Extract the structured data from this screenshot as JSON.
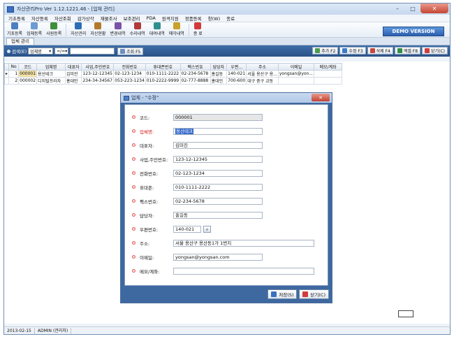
{
  "window": {
    "title": "자산관리Pro Ver 1.12.1221.46 - [업체 관리]"
  },
  "menu": [
    "기초등록",
    "자산등록",
    "자산조회",
    "감가상각",
    "재물조사",
    "보조관리",
    "PDA",
    "원격지원",
    "정품등록",
    "창(W)",
    "종료"
  ],
  "toolbar": {
    "buttons": [
      {
        "label": "기초등록",
        "icon": "folder-icon",
        "color": "#4a7fc1"
      },
      {
        "label": "업체등록",
        "icon": "building-icon",
        "color": "#6b9bd2"
      },
      {
        "label": "사원등록",
        "icon": "user-icon",
        "color": "#3f8e3a"
      },
      {
        "label": "자산관리",
        "icon": "box-icon",
        "color": "#2c6db3"
      },
      {
        "label": "자산현황",
        "icon": "chart-icon",
        "color": "#b37a2c"
      },
      {
        "label": "변경내역",
        "icon": "list-icon",
        "color": "#7a52a8"
      },
      {
        "label": "수리내역",
        "icon": "wrench-icon",
        "color": "#b23a3a"
      },
      {
        "label": "대여내역",
        "icon": "handover-icon",
        "color": "#2f8f8f"
      },
      {
        "label": "매각내역",
        "icon": "sale-icon",
        "color": "#c9a22a"
      },
      {
        "label": "종 료",
        "icon": "power-icon",
        "color": "#d23b3b"
      }
    ],
    "demo_label": "DEMO VERSION"
  },
  "tab": {
    "label": "업체 관리"
  },
  "search": {
    "label": "검색(E)",
    "field_select": "업체명",
    "op_select": "=/=",
    "query": "",
    "search_btn": "조회 F5"
  },
  "actions": {
    "add": "추가 F2",
    "edit": "수정 F3",
    "delete": "삭제 F4",
    "excel": "엑셀 F8",
    "close": "닫기(C)"
  },
  "grid": {
    "columns": [
      "No",
      "코드",
      "업체명",
      "대표자",
      "사업,주민번호",
      "전화번호",
      "휴대폰번호",
      "팩스번호",
      "담당자",
      "우편...",
      "주소",
      "이메일",
      "메모/계좌"
    ],
    "rows": [
      [
        "1",
        "000001",
        "용산테크",
        "김미진",
        "123-12-12345",
        "02-123-1234",
        "010-1111-2222",
        "02-234-5678",
        "홍길동",
        "140-021",
        "서울 용산구 용...",
        "yongsan@yon...",
        ""
      ],
      [
        "2",
        "000002",
        "디지털프라자",
        "홍대민",
        "234-34-34567",
        "053-223-1234",
        "010-2222-9999",
        "02-777-8888",
        "홍대민",
        "700-600",
        "대구 중구 교동",
        "",
        ""
      ]
    ]
  },
  "dialog": {
    "title": "업체 - \"수정\"",
    "fields": [
      {
        "label": "코드:",
        "value": "000001",
        "required": false
      },
      {
        "label": "업체명:",
        "value": "용산테크",
        "required": true
      },
      {
        "label": "대표자:",
        "value": "김미진",
        "required": false
      },
      {
        "label": "사업,주민번호:",
        "value": "123-12-12345",
        "required": false
      },
      {
        "label": "전화번호:",
        "value": "02-123-1234",
        "required": false
      },
      {
        "label": "휴대폰:",
        "value": "010-1111-2222",
        "required": false
      },
      {
        "label": "팩스번호:",
        "value": "02-234-5678",
        "required": false
      },
      {
        "label": "담당자:",
        "value": "홍길동",
        "required": false
      },
      {
        "label": "우편번호:",
        "value": "140-021",
        "required": false
      },
      {
        "label": "주소:",
        "value": "서울 용산구 용산동1가 1번지",
        "required": false
      },
      {
        "label": "이메일:",
        "value": "yongsan@yongsan.com",
        "required": false
      },
      {
        "label": "메모/계좌:",
        "value": "",
        "required": false
      }
    ],
    "save_btn": "저장(S)",
    "close_btn": "닫기(C)",
    "zip_icon": "search-icon"
  },
  "status": {
    "date": "2013-02-15",
    "user": "ADMIN (관리자)"
  }
}
